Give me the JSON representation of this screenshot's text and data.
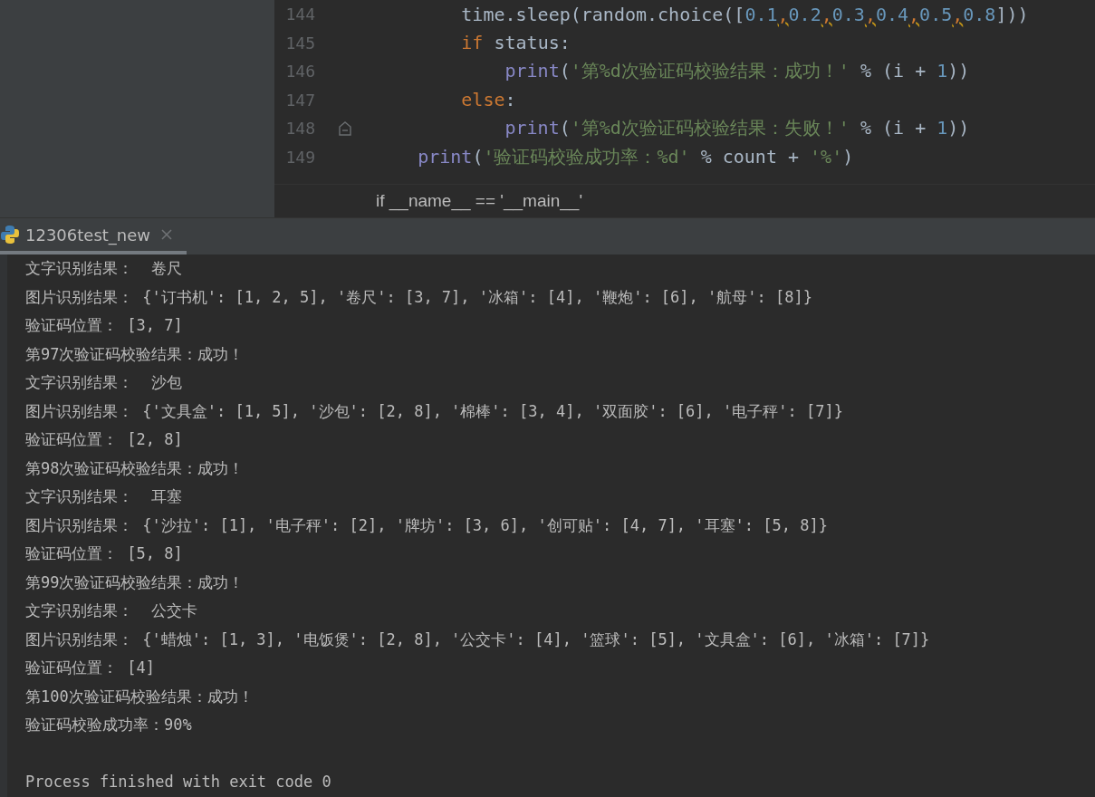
{
  "editor": {
    "lines": [
      {
        "number": "144",
        "fold": false,
        "tokens": [
          {
            "kind": "plain",
            "text": "        time.sleep(random.choice(["
          },
          {
            "kind": "number",
            "text": "0.1"
          },
          {
            "kind": "warn",
            "text": ","
          },
          {
            "kind": "number",
            "text": "0.2"
          },
          {
            "kind": "warn",
            "text": ","
          },
          {
            "kind": "number",
            "text": "0.3"
          },
          {
            "kind": "warn",
            "text": ","
          },
          {
            "kind": "number",
            "text": "0.4"
          },
          {
            "kind": "warn",
            "text": ","
          },
          {
            "kind": "number",
            "text": "0.5"
          },
          {
            "kind": "warn",
            "text": ","
          },
          {
            "kind": "number",
            "text": "0.8"
          },
          {
            "kind": "plain",
            "text": "]))"
          }
        ]
      },
      {
        "number": "145",
        "fold": false,
        "tokens": [
          {
            "kind": "keyword",
            "text": "        if"
          },
          {
            "kind": "plain",
            "text": " status:"
          }
        ]
      },
      {
        "number": "146",
        "fold": false,
        "tokens": [
          {
            "kind": "builtin",
            "text": "            print"
          },
          {
            "kind": "plain",
            "text": "("
          },
          {
            "kind": "string",
            "text": "'第%d次验证码校验结果：成功！'"
          },
          {
            "kind": "plain",
            "text": " % (i + "
          },
          {
            "kind": "number",
            "text": "1"
          },
          {
            "kind": "plain",
            "text": "))"
          }
        ]
      },
      {
        "number": "147",
        "fold": false,
        "tokens": [
          {
            "kind": "keyword",
            "text": "        else"
          },
          {
            "kind": "plain",
            "text": ":"
          }
        ]
      },
      {
        "number": "148",
        "fold": true,
        "tokens": [
          {
            "kind": "builtin",
            "text": "            print"
          },
          {
            "kind": "plain",
            "text": "("
          },
          {
            "kind": "string",
            "text": "'第%d次验证码校验结果：失败！'"
          },
          {
            "kind": "plain",
            "text": " % (i + "
          },
          {
            "kind": "number",
            "text": "1"
          },
          {
            "kind": "plain",
            "text": "))"
          }
        ]
      },
      {
        "number": "149",
        "fold": false,
        "tokens": [
          {
            "kind": "builtin",
            "text": "    print"
          },
          {
            "kind": "plain",
            "text": "("
          },
          {
            "kind": "string",
            "text": "'验证码校验成功率：%d'"
          },
          {
            "kind": "plain",
            "text": " % count + "
          },
          {
            "kind": "string",
            "text": "'%'"
          },
          {
            "kind": "plain",
            "text": ")"
          }
        ]
      }
    ]
  },
  "breadcrumb": "if __name__ == '__main__'",
  "run_tab": {
    "label": "12306test_new",
    "selected": true
  },
  "console": {
    "lines": [
      "文字识别结果：  卷尺",
      "图片识别结果： {'订书机': [1, 2, 5], '卷尺': [3, 7], '冰箱': [4], '鞭炮': [6], '航母': [8]}",
      "验证码位置： [3, 7]",
      "第97次验证码校验结果：成功！",
      "文字识别结果：  沙包",
      "图片识别结果： {'文具盒': [1, 5], '沙包': [2, 8], '棉棒': [3, 4], '双面胶': [6], '电子秤': [7]}",
      "验证码位置： [2, 8]",
      "第98次验证码校验结果：成功！",
      "文字识别结果：  耳塞",
      "图片识别结果： {'沙拉': [1], '电子秤': [2], '牌坊': [3, 6], '创可贴': [4, 7], '耳塞': [5, 8]}",
      "验证码位置： [5, 8]",
      "第99次验证码校验结果：成功！",
      "文字识别结果：  公交卡",
      "图片识别结果： {'蜡烛': [1, 3], '电饭煲': [2, 8], '公交卡': [4], '篮球': [5], '文具盒': [6], '冰箱': [7]}",
      "验证码位置： [4]",
      "第100次验证码校验结果：成功！",
      "验证码校验成功率：90%"
    ],
    "exit_message": "Process finished with exit code 0"
  }
}
